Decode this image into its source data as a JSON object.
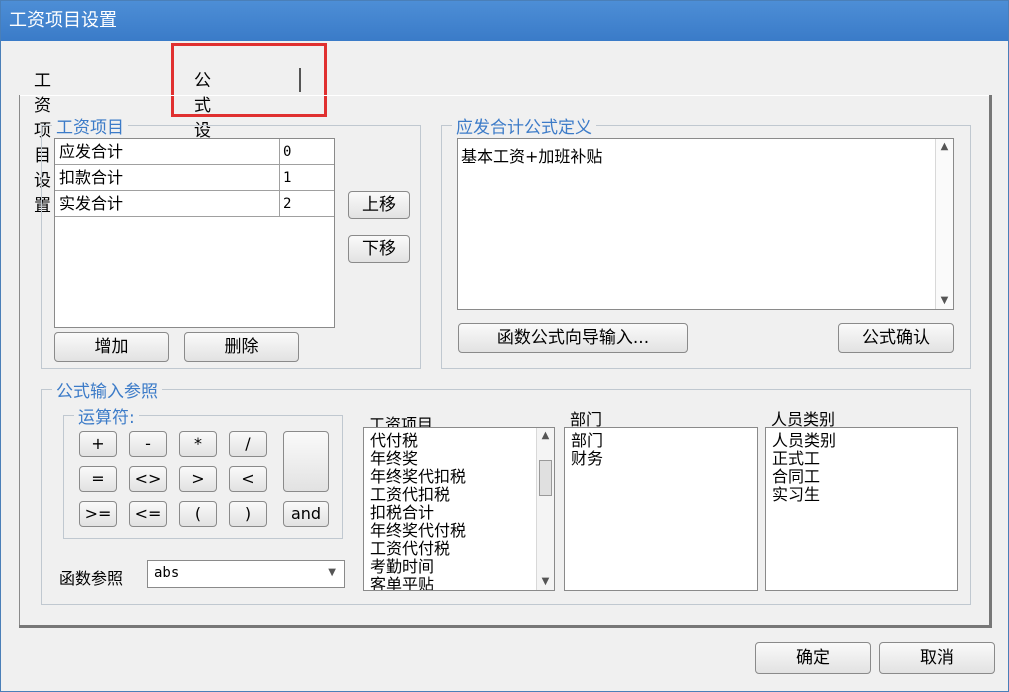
{
  "window": {
    "title": "工资项目设置"
  },
  "tabs": [
    {
      "label": "工资项目设置"
    },
    {
      "label": "公式设置"
    }
  ],
  "salary_items": {
    "legend": "工资项目",
    "rows": [
      {
        "name": "应发合计",
        "value": "0"
      },
      {
        "name": "扣款合计",
        "value": "1"
      },
      {
        "name": "实发合计",
        "value": "2"
      }
    ],
    "move_up": "上移",
    "move_down": "下移",
    "add": "增加",
    "delete": "删除"
  },
  "formula_def": {
    "legend": "应发合计公式定义",
    "formula": "基本工资+加班补贴",
    "wizard_button": "函数公式向导输入...",
    "confirm_button": "公式确认"
  },
  "formula_ref": {
    "legend": "公式输入参照",
    "operators_label": "运算符:",
    "operators": [
      "+",
      "-",
      "*",
      "/",
      "=",
      "<>",
      ">",
      "<",
      ">=",
      "<=",
      "(",
      ")",
      "and"
    ],
    "function_label": "函数参照",
    "function_value": "abs",
    "salary_list_title": "工资项目",
    "salary_list": [
      "代付税",
      "年终奖",
      "年终奖代扣税",
      "工资代扣税",
      "扣税合计",
      "年终奖代付税",
      "工资代付税",
      "考勤时间",
      "客单平贴"
    ],
    "dept_title": "部门",
    "dept_list": [
      "部门",
      "财务"
    ],
    "staff_title": "人员类别",
    "staff_list": [
      "人员类别",
      "正式工",
      "合同工",
      "实习生"
    ]
  },
  "footer": {
    "ok": "确定",
    "cancel": "取消"
  },
  "colors": {
    "accent": "#3c7bc8",
    "highlight": "#e03030",
    "title_bar": "#3a7bc8"
  }
}
